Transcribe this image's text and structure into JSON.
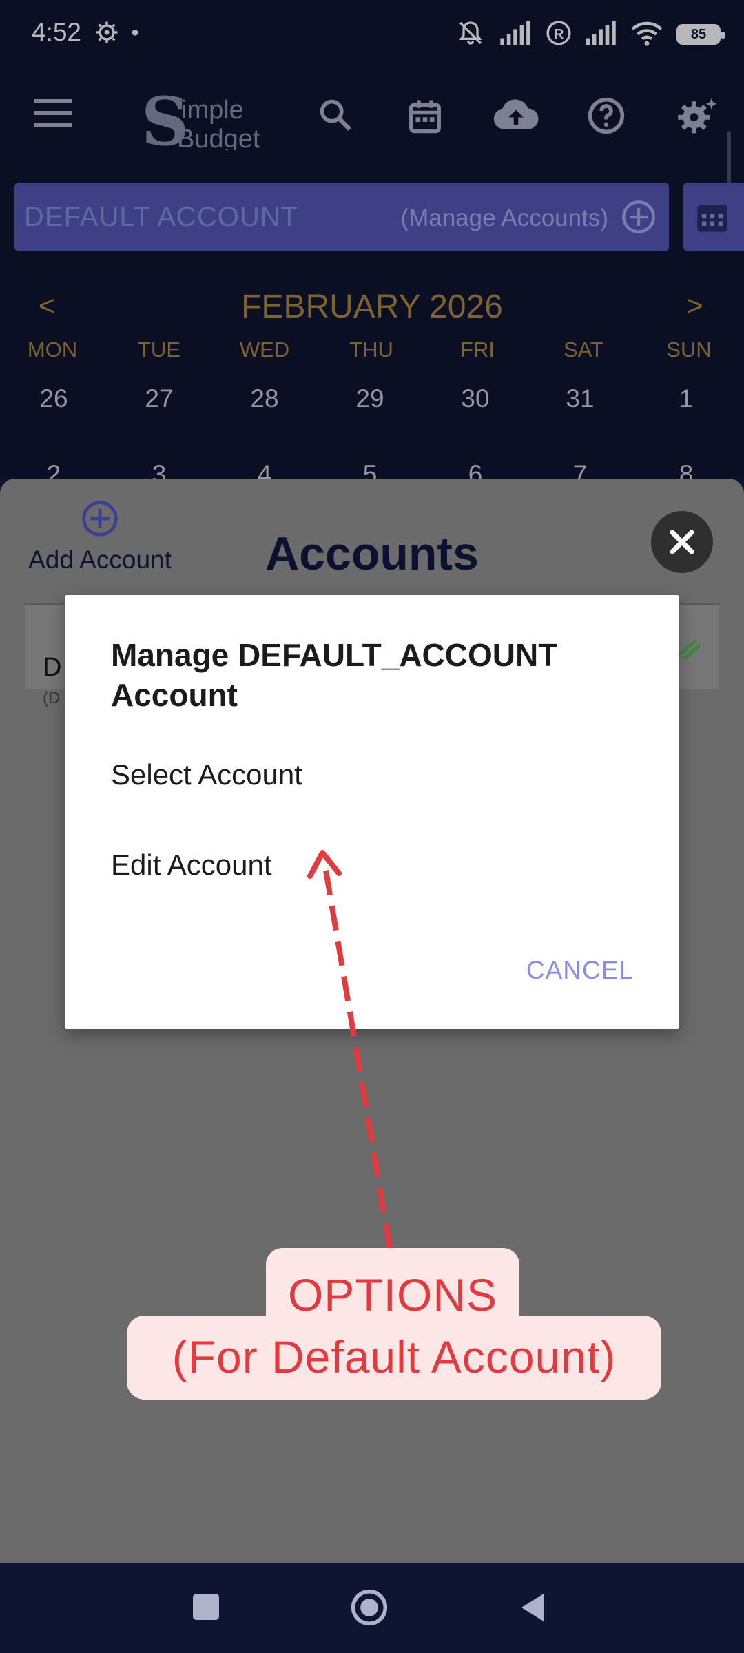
{
  "status_bar": {
    "time": "4:52",
    "battery": "85"
  },
  "app": {
    "logo_line1": "imple",
    "logo_line2": "Budget",
    "logo_initial": "S"
  },
  "account_bar": {
    "name": "DEFAULT ACCOUNT",
    "manage_label": "(Manage Accounts)"
  },
  "calendar": {
    "prev": "<",
    "next": ">",
    "month": "FEBRUARY 2026",
    "weekdays": [
      "MON",
      "TUE",
      "WED",
      "THU",
      "FRI",
      "SAT",
      "SUN"
    ],
    "week1": [
      "26",
      "27",
      "28",
      "29",
      "30",
      "31",
      "1"
    ],
    "week2": [
      "2",
      "3",
      "4",
      "5",
      "6",
      "7",
      "8"
    ]
  },
  "sheet": {
    "add_account_label": "Add Account",
    "title": "Accounts",
    "account_row_initial": "D",
    "account_row_sub": "(D"
  },
  "dialog": {
    "title": "Manage DEFAULT_ACCOUNT Account",
    "options": [
      "Select Account",
      "Edit Account"
    ],
    "cancel": "CANCEL"
  },
  "annotation": {
    "line1": "OPTIONS",
    "line2": "(For Default Account)",
    "color": "#e33a3f"
  },
  "colors": {
    "app_background": "#0e1533",
    "account_bar": "#5658b8",
    "calendar_text": "#b08a3f",
    "sheet": "#6b6b6b",
    "cancel_text": "#8a8de6"
  }
}
